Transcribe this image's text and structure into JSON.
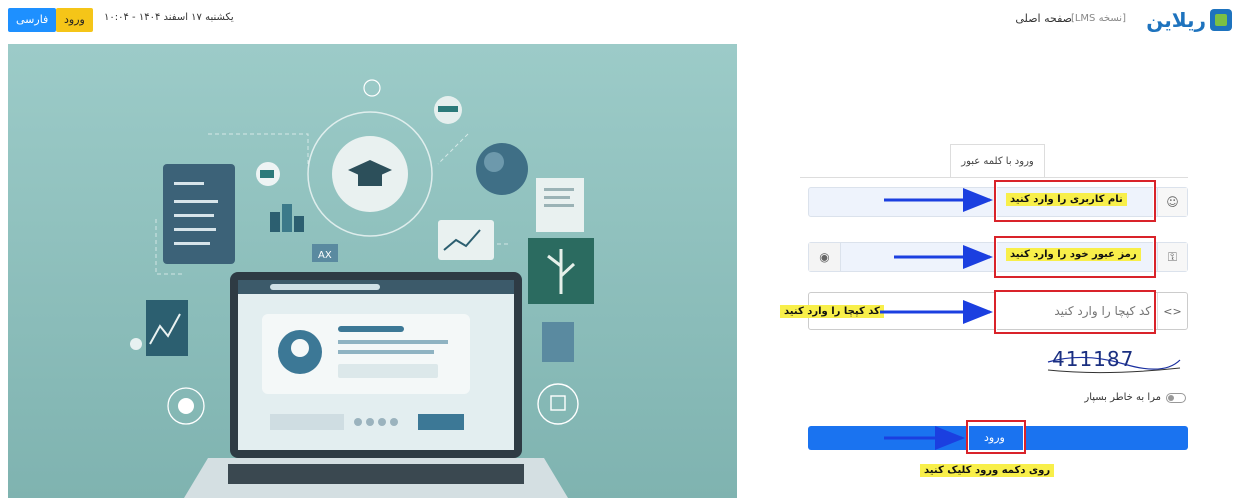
{
  "header": {
    "lang_label": "فارسی",
    "login_label": "ورود",
    "datetime": "یکشنبه ۱۷ اسفند ۱۴۰۴ - ۱۰:۰۴",
    "logo_text": "ریلاین",
    "version": "[نسخه LMS]",
    "home_label": "صفحه اصلی"
  },
  "illustration": {
    "ax_label": "AX"
  },
  "login": {
    "tab_label": "ورود با کلمه عبور",
    "username_note": "نام کاربری را وارد کنید",
    "password_note": "رمز عبور خود را وارد کنید",
    "captcha_placeholder": "کد کپچا را وارد کنید",
    "captcha_note": "کد کپچا را وارد کنید",
    "captcha_code": "411187",
    "remember_label": "مرا به خاطر بسپار",
    "submit_label": "ورود",
    "submit_note": "روی دکمه ورود کلیک کنید"
  },
  "colors": {
    "primary": "#1a73f0",
    "accent_yellow": "#f5c518",
    "annotation_red": "#d9232a",
    "annotation_blue": "#1b3fe0",
    "illustration_bg": "#8fc0bd"
  }
}
